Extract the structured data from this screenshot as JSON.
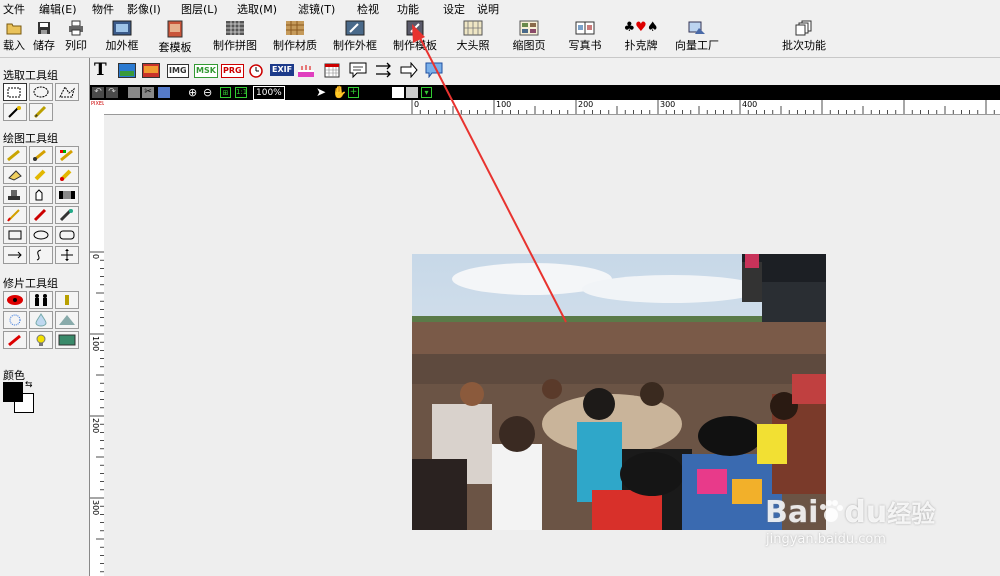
{
  "menu": [
    "文件",
    "编辑(E)",
    "物件",
    "影像(I)",
    "图层(L)",
    "选取(M)",
    "滤镜(T)",
    "检视",
    "功能",
    "设定",
    "说明"
  ],
  "main_toolbar": [
    "载入",
    "储存",
    "列印",
    "加外框",
    "套模板",
    "制作拼图",
    "制作材质",
    "制作外框",
    "制作模板",
    "大头照",
    "缩图页",
    "写真书",
    "扑克牌",
    "向量工厂",
    "批次功能"
  ],
  "left_panel": {
    "select_group": "选取工具组",
    "draw_group": "绘图工具组",
    "retouch_group": "修片工具组",
    "color_label": "颜色"
  },
  "tool_toolbar": {
    "text_tool": "T",
    "img_label": "IMG",
    "msk_label": "MSK",
    "prg_label": "PRG",
    "exif_label": "EXIF"
  },
  "blackbar": {
    "zoom": "100%"
  },
  "ruler": {
    "h_labels": [
      "0",
      "100",
      "200",
      "300",
      "400"
    ],
    "v_labels": [
      "0",
      "100",
      "200",
      "300"
    ],
    "corner": "PIXEL"
  },
  "watermark": {
    "brand": "Bai",
    "brand2": "du",
    "suffix": "经验",
    "url": "jingyan.baidu.com"
  },
  "colors": {
    "annotation_arrow": "#e8332f",
    "background": "#f0f0f0"
  }
}
